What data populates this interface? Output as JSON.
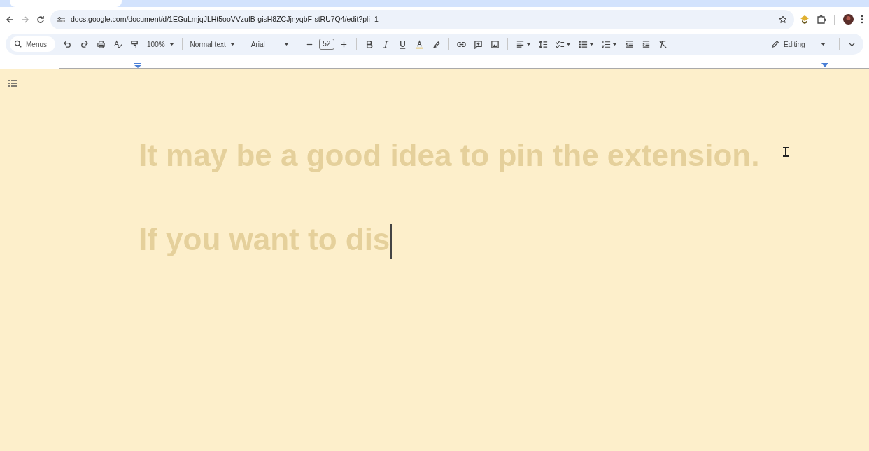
{
  "browser": {
    "url": "docs.google.com/document/d/1EGuLmjqJLHt5ooVVzufB-gisH8ZCJjnyqbF-stRU7Q4/edit?pli=1"
  },
  "toolbar": {
    "search": "Menus",
    "zoom": "100%",
    "style": "Normal text",
    "font": "Arial",
    "font_size": "52",
    "mode": "Editing"
  },
  "document": {
    "paragraphs": [
      {
        "text": "It may be a good idea to pin the extension.",
        "caret": false
      },
      {
        "text": "If you want to dis",
        "caret": true
      }
    ]
  }
}
